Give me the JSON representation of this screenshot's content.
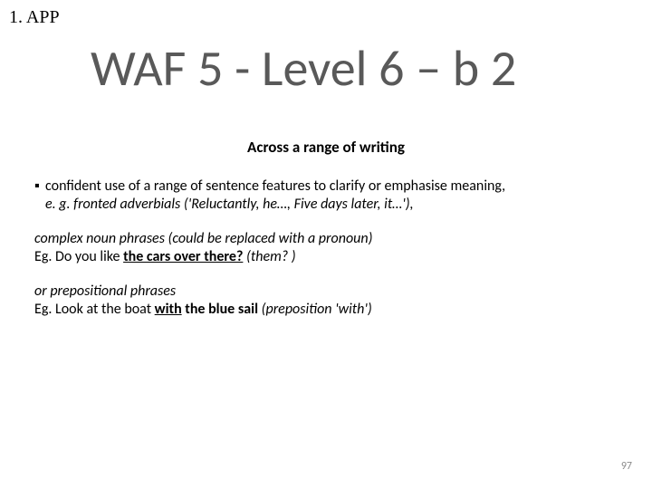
{
  "header": {
    "label": "1. APP"
  },
  "title": "WAF 5 - Level 6 – b 2",
  "subtitle": "Across a range of writing",
  "content": {
    "bullet_mark": "▪",
    "p1_lead": "confident use of a range of sentence features to clarify or emphasise meaning,",
    "p1_eg": "e. g. fronted adverbials ('Reluctantly, he…, Five days later, it…'),",
    "p2_line1": "complex noun phrases (could be replaced with a pronoun)",
    "p2_eg_prefix": "Eg. Do you like ",
    "p2_eg_bold": "the cars over there?",
    "p2_eg_suffix": "  (them? )",
    "p3_line1": "or prepositional phrases",
    "p3_eg_prefix": "Eg. Look at the boat ",
    "p3_eg_with": "with",
    "p3_eg_rest": " the blue sail",
    "p3_eg_suffix": "  (preposition 'with')"
  },
  "page_number": "97"
}
